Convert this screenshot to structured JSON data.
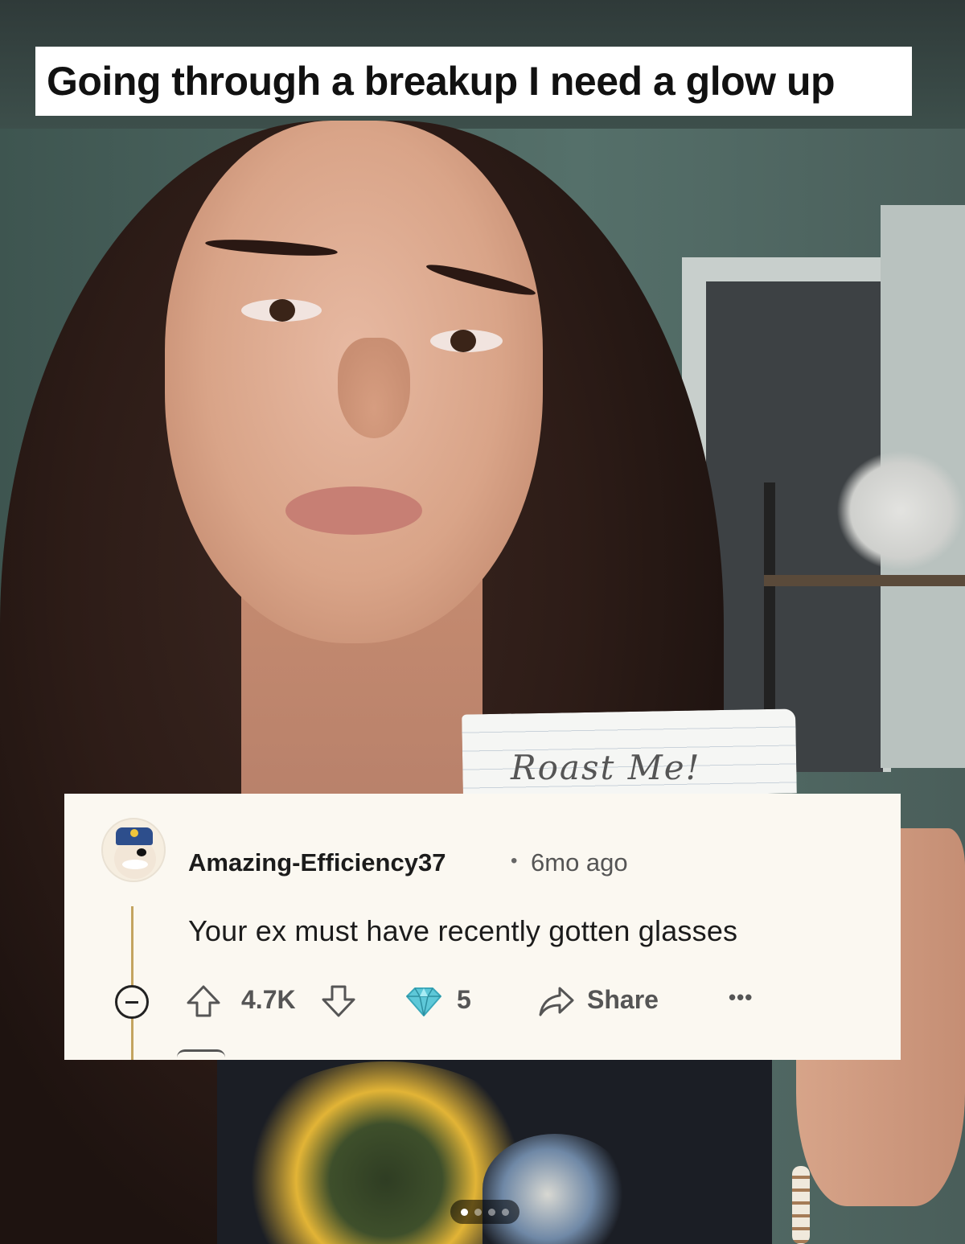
{
  "post": {
    "title": "Going through a breakup I need a glow up",
    "sign_text": "Roast Me!"
  },
  "comment": {
    "username": "Amazing-Efficiency37",
    "separator": "•",
    "time_ago": "6mo ago",
    "body": "Your ex must have recently gotten glasses",
    "upvotes": "4.7K",
    "awards": "5",
    "share_label": "Share",
    "more_label": "•••"
  },
  "carousel": {
    "total": 4,
    "active_index": 0
  },
  "colors": {
    "card_background": "#fbf8f1",
    "thread_line": "#c3a460",
    "award_gem": "#5ec8d8",
    "text_primary": "#1c1c1c",
    "text_secondary": "#555555"
  },
  "icons": {
    "upvote": "arrow-up-icon",
    "downvote": "arrow-down-icon",
    "award": "diamond-award-icon",
    "share": "share-arrow-icon",
    "more": "more-options-icon",
    "collapse": "collapse-minus-icon"
  }
}
